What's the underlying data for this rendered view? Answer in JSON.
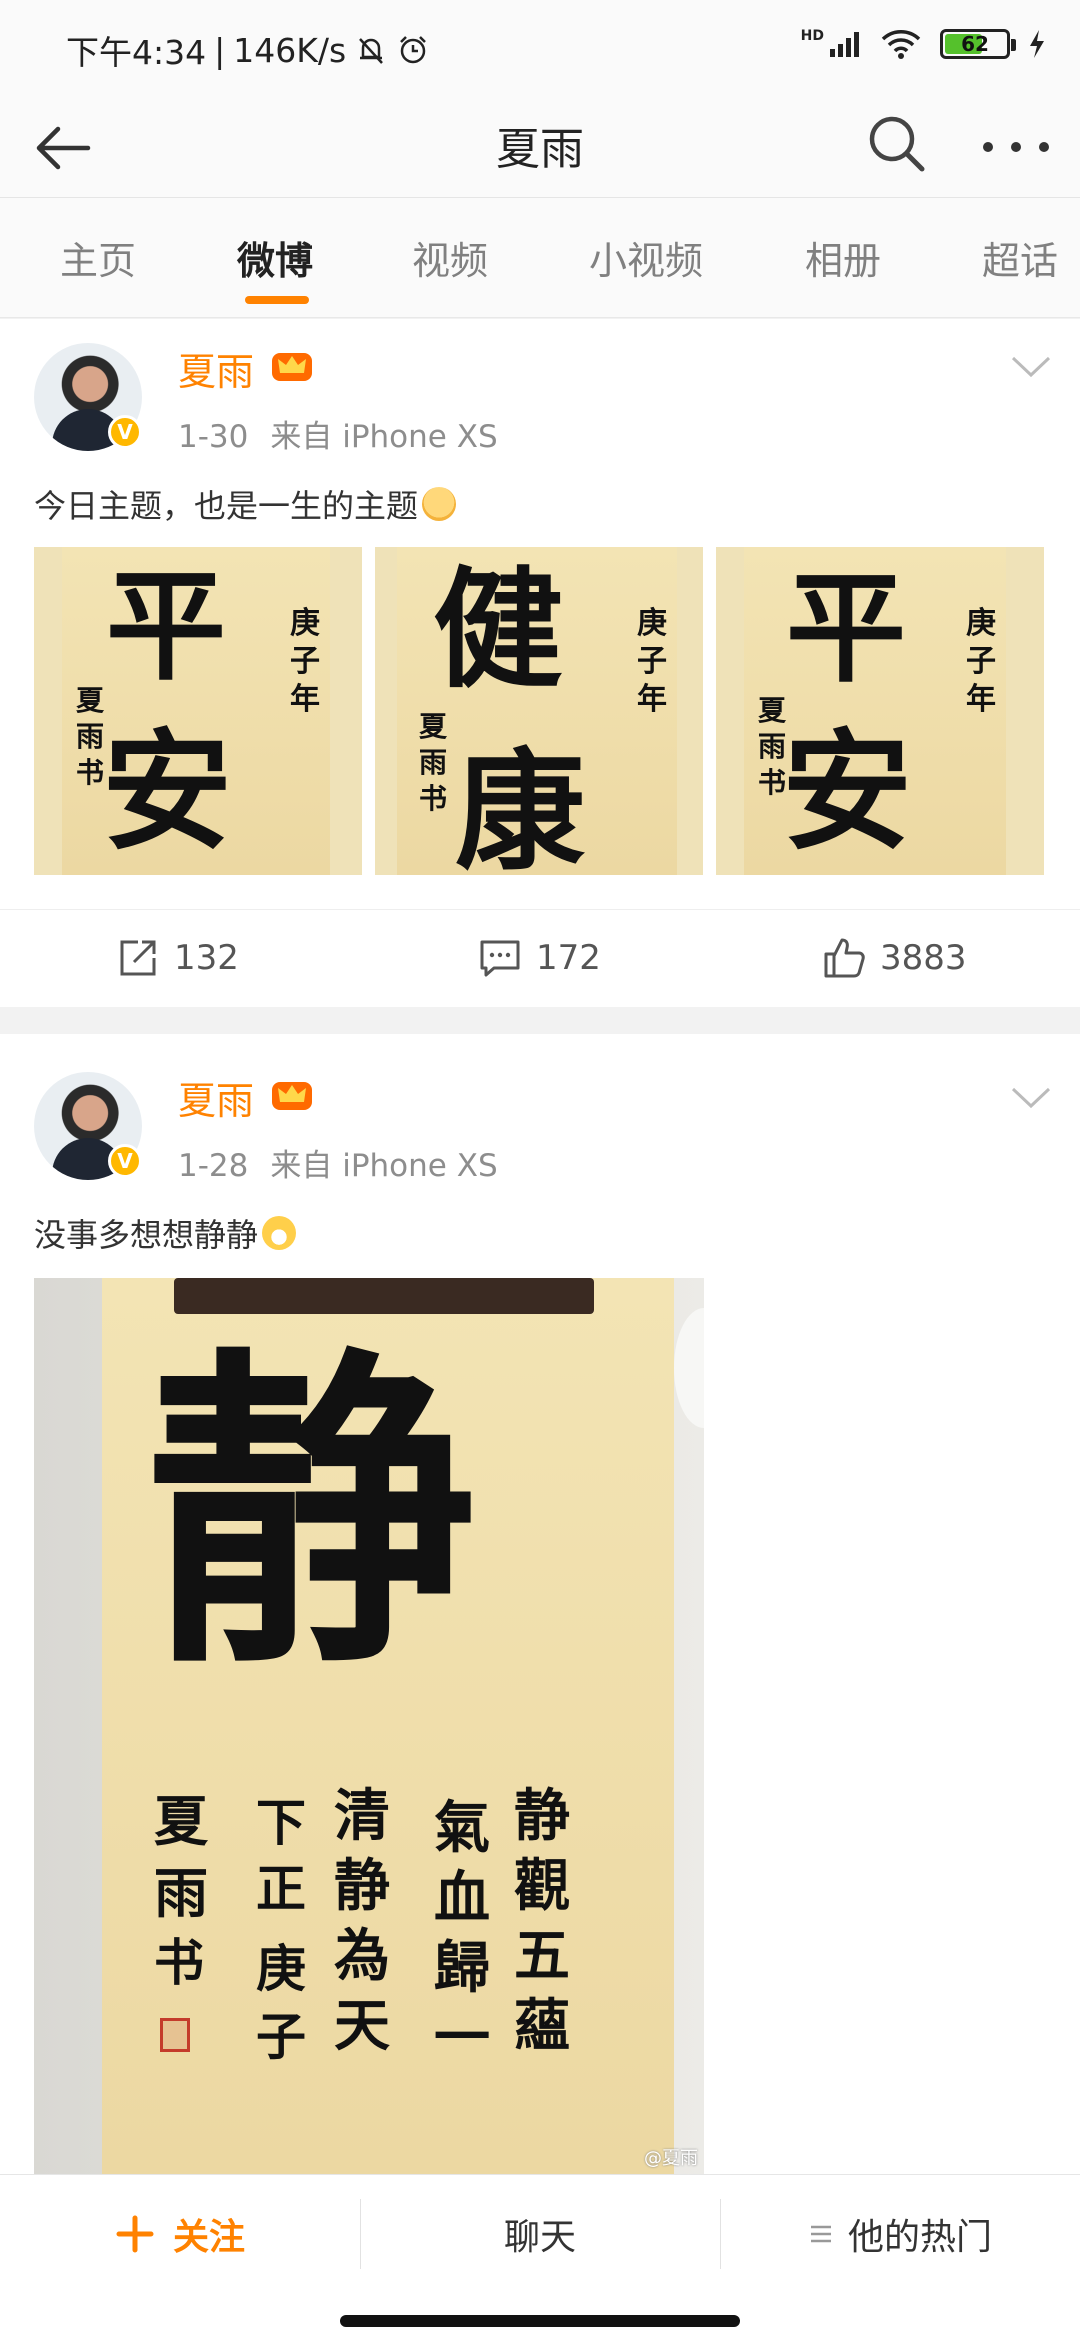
{
  "status_bar": {
    "time": "下午4:34",
    "net_speed": "146K/s",
    "signal_label": "HD",
    "battery": "62",
    "battery_level": 0.62
  },
  "header": {
    "title": "夏雨"
  },
  "tabs": [
    "主页",
    "微博",
    "视频",
    "小视频",
    "相册",
    "超话"
  ],
  "active_tab": "微博",
  "posts": [
    {
      "username": "夏雨",
      "date": "1-30",
      "source": "来自 iPhone XS",
      "text": "今日主题，也是一生的主题",
      "images": [
        {
          "big": [
            "平",
            "安"
          ],
          "side_right": [
            "庚",
            "子",
            "年"
          ],
          "side_left": [
            "夏",
            "雨",
            "书"
          ]
        },
        {
          "big": [
            "健",
            "康"
          ],
          "side_right": [
            "庚",
            "子",
            "年"
          ],
          "side_left": [
            "夏",
            "雨",
            "书"
          ]
        },
        {
          "big": [
            "平",
            "安"
          ],
          "side_right": [
            "庚",
            "子",
            "年"
          ],
          "side_left": [
            "夏",
            "雨",
            "书"
          ]
        }
      ],
      "reposts": "132",
      "comments": "172",
      "likes": "3883"
    },
    {
      "username": "夏雨",
      "date": "1-28",
      "source": "来自 iPhone XS",
      "text": "没事多想想静静",
      "image": {
        "big": "静",
        "col1": [
          "静",
          "觀",
          "五",
          "蘊"
        ],
        "col2": [
          "氣",
          "血",
          "歸",
          "一"
        ],
        "col3": [
          "清",
          "静",
          "為",
          "天"
        ],
        "col4": [
          "下",
          "正",
          "庚",
          "子"
        ],
        "col5": [
          "夏",
          "雨",
          "书"
        ],
        "watermark": "@夏雨"
      }
    }
  ],
  "bottom_bar": {
    "follow": "关注",
    "chat": "聊天",
    "hot": "他的热门"
  },
  "colors": {
    "accent": "#ff8200",
    "username": "#ff8200",
    "verified": "#ffb800"
  },
  "icons": {
    "back": "arrow-left-icon",
    "search": "search-icon",
    "more": "more-dots-icon",
    "repost": "share-icon",
    "comment": "comment-icon",
    "like": "thumbs-up-icon"
  }
}
